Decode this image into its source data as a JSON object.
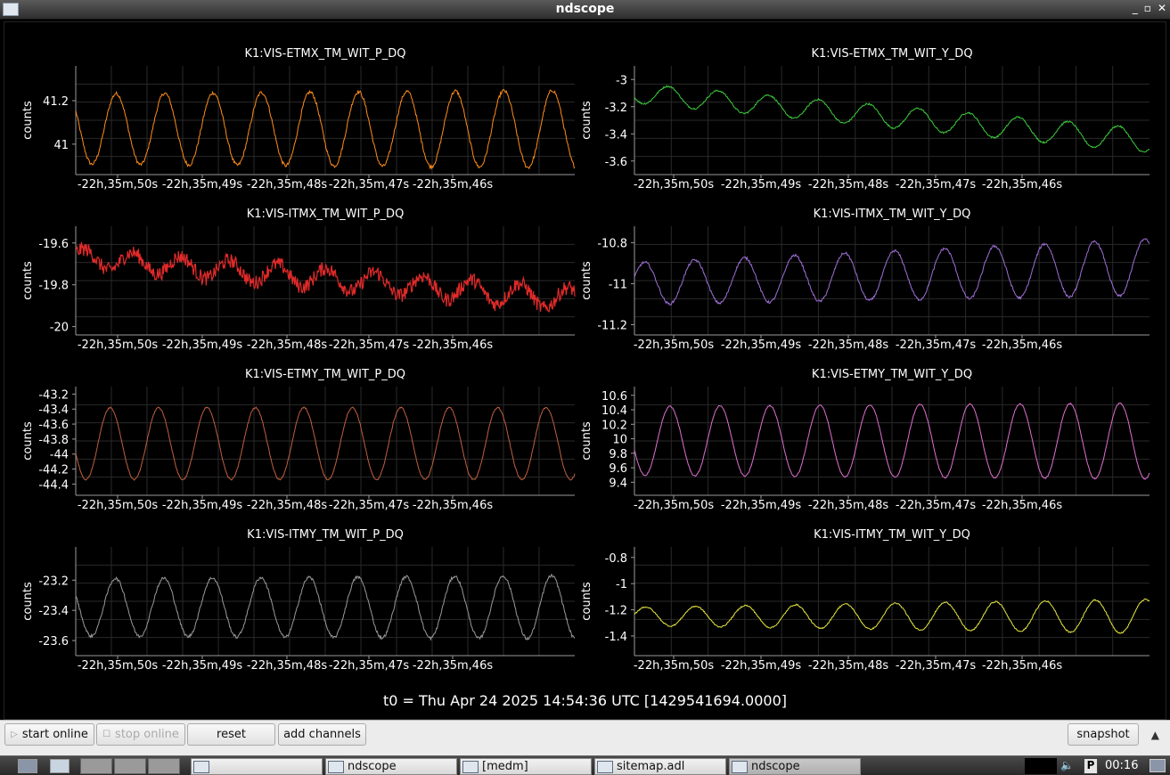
{
  "window": {
    "title": "ndscope"
  },
  "time_label": "t0 = Thu Apr 24 2025 14:54:36 UTC [1429541694.0000]",
  "colors": {
    "grid": "#2a2a2a",
    "axis": "#9a9a9a",
    "text": "#ffffff"
  },
  "toolbar": {
    "start_online": "start online",
    "stop_online": "stop online",
    "reset": "reset",
    "add_channels": "add channels",
    "snapshot": "snapshot"
  },
  "taskbar": {
    "tasks": [
      "",
      "ndscope",
      "[medm]",
      "sitemap.adl",
      "ndscope"
    ],
    "clock": "00:16",
    "tray_p": "P"
  },
  "chart_data": [
    {
      "type": "line",
      "title": "K1:VIS-ETMX_TM_WIT_P_DQ",
      "ylabel": "counts",
      "color": "#ff8c1a",
      "xticks": [
        "-22h,35m,50s",
        "-22h,35m,49s",
        "-22h,35m,48s",
        "-22h,35m,47s",
        "-22h,35m,46s"
      ],
      "yticks": [
        41,
        41.2
      ],
      "ylim": [
        40.86,
        41.36
      ],
      "wave": {
        "mean": 41.07,
        "amp": 0.17,
        "drift": 0,
        "cycles": 10.3,
        "phase": 2.6,
        "noise": 0.008,
        "amp_growth": 0.1
      }
    },
    {
      "type": "line",
      "title": "K1:VIS-ETMX_TM_WIT_Y_DQ",
      "ylabel": "counts",
      "color": "#3ccc3c",
      "xticks": [
        "-22h,35m,50s",
        "-22h,35m,49s",
        "-22h,35m,48s",
        "-22h,35m,47s",
        "-22h,35m,46s"
      ],
      "yticks": [
        -3,
        -3.2,
        -3.4,
        -3.6
      ],
      "ylim": [
        -3.7,
        -2.9
      ],
      "wave": {
        "mean": -3.1,
        "amp": 0.08,
        "drift": -0.35,
        "cycles": 10.3,
        "phase": 3.6,
        "noise": 0.006,
        "amp_growth": 0.2
      }
    },
    {
      "type": "line",
      "title": "K1:VIS-ITMX_TM_WIT_P_DQ",
      "ylabel": "counts",
      "color": "#e02a2a",
      "xticks": [
        "-22h,35m,50s",
        "-22h,35m,49s",
        "-22h,35m,48s",
        "-22h,35m,47s",
        "-22h,35m,46s"
      ],
      "yticks": [
        -19.6,
        -19.8,
        -20
      ],
      "ylim": [
        -20.04,
        -19.52
      ],
      "wave": {
        "mean": -19.67,
        "amp": 0.05,
        "drift": -0.2,
        "cycles": 10.3,
        "phase": 0.5,
        "noise": 0.035,
        "amp_growth": 0.2
      }
    },
    {
      "type": "line",
      "title": "K1:VIS-ITMX_TM_WIT_Y_DQ",
      "ylabel": "counts",
      "color": "#a070d8",
      "xticks": [
        "-22h,35m,50s",
        "-22h,35m,49s",
        "-22h,35m,48s",
        "-22h,35m,47s",
        "-22h,35m,46s"
      ],
      "yticks": [
        -10.8,
        -11,
        -11.2
      ],
      "ylim": [
        -11.25,
        -10.72
      ],
      "wave": {
        "mean": -11.0,
        "amp": 0.12,
        "drift": 0.08,
        "cycles": 10.3,
        "phase": 0.3,
        "noise": 0.006,
        "amp_growth": 0.3
      }
    },
    {
      "type": "line",
      "title": "K1:VIS-ETMY_TM_WIT_P_DQ",
      "ylabel": "counts",
      "color": "#c06040",
      "xticks": [
        "-22h,35m,50s",
        "-22h,35m,49s",
        "-22h,35m,48s",
        "-22h,35m,47s",
        "-22h,35m,46s"
      ],
      "yticks": [
        -43.2,
        -43.4,
        -43.6,
        -43.8,
        -44,
        -44.2,
        -44.4
      ],
      "ylim": [
        -44.55,
        -43.1
      ],
      "wave": {
        "mean": -43.86,
        "amp": 0.48,
        "drift": 0,
        "cycles": 10.3,
        "phase": 3.4,
        "noise": 0.01,
        "amp_growth": 0
      }
    },
    {
      "type": "line",
      "title": "K1:VIS-ETMY_TM_WIT_Y_DQ",
      "ylabel": "counts",
      "color": "#e070d0",
      "xticks": [
        "-22h,35m,50s",
        "-22h,35m,49s",
        "-22h,35m,48s",
        "-22h,35m,47s",
        "-22h,35m,46s"
      ],
      "yticks": [
        10.6,
        10.4,
        10.2,
        10,
        9.8,
        9.6,
        9.4
      ],
      "ylim": [
        9.22,
        10.72
      ],
      "wave": {
        "mean": 9.97,
        "amp": 0.5,
        "drift": 0,
        "cycles": 10.3,
        "phase": 3.4,
        "noise": 0.008,
        "amp_growth": 0.1
      }
    },
    {
      "type": "line",
      "title": "K1:VIS-ITMY_TM_WIT_P_DQ",
      "ylabel": "counts",
      "color": "#9a9a9a",
      "xticks": [
        "-22h,35m,50s",
        "-22h,35m,49s",
        "-22h,35m,48s",
        "-22h,35m,47s",
        "-22h,35m,46s"
      ],
      "yticks": [
        -23.2,
        -23.4,
        -23.6
      ],
      "ylim": [
        -23.7,
        -22.98
      ],
      "wave": {
        "mean": -23.38,
        "amp": 0.2,
        "drift": 0,
        "cycles": 10.3,
        "phase": 2.7,
        "noise": 0.01,
        "amp_growth": 0.1
      }
    },
    {
      "type": "line",
      "title": "K1:VIS-ITMY_TM_WIT_Y_DQ",
      "ylabel": "counts",
      "color": "#e8e840",
      "xticks": [
        "-22h,35m,50s",
        "-22h,35m,49s",
        "-22h,35m,48s",
        "-22h,35m,47s",
        "-22h,35m,46s"
      ],
      "yticks": [
        -0.8,
        -1,
        -1.2,
        -1.4
      ],
      "ylim": [
        -1.55,
        -0.72
      ],
      "wave": {
        "mean": -1.25,
        "amp": 0.1,
        "drift": 0,
        "cycles": 10.3,
        "phase": 0.2,
        "noise": 0.005,
        "amp_growth": 0.6
      }
    }
  ]
}
